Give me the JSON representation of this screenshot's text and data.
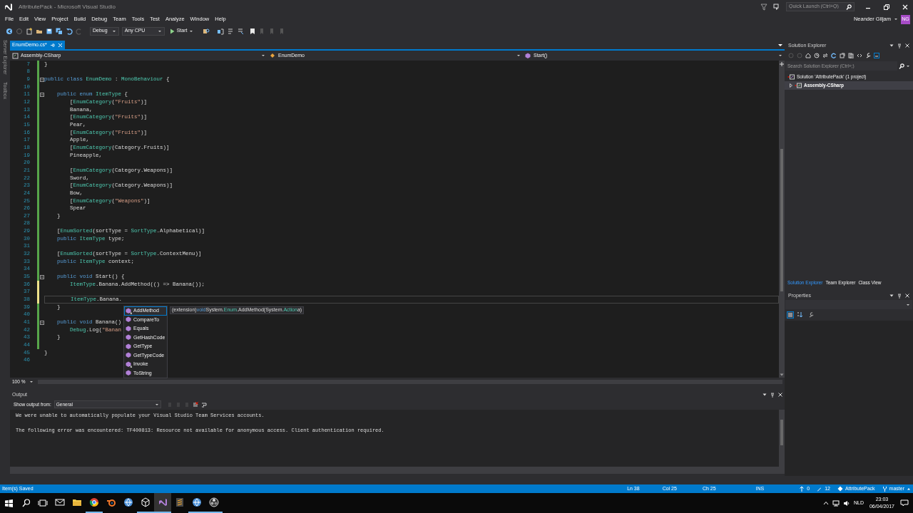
{
  "window": {
    "title": "AttributePack - Microsoft Visual Studio",
    "quick_launch": {
      "placeholder": "Quick Launch (Ctrl+Q)"
    },
    "user": {
      "name": "Neander Giljam",
      "initials": "NG"
    }
  },
  "menu": [
    "File",
    "Edit",
    "View",
    "Project",
    "Build",
    "Debug",
    "Team",
    "Tools",
    "Test",
    "Analyze",
    "Window",
    "Help"
  ],
  "toolbar": {
    "configuration": "Debug",
    "platform": "Any CPU",
    "start": "Start"
  },
  "side_tabs": [
    "Server Explorer",
    "Toolbox"
  ],
  "editor": {
    "tabs": [
      {
        "label": "EnumDemo.cs*",
        "selected": true
      }
    ],
    "nav": [
      "Assembly-CSharp",
      "EnumDemo",
      "Start()"
    ],
    "lines": [
      {
        "n": "7",
        "code": [
          {
            "text": "}",
            "kind": "plain"
          }
        ],
        "changed": true,
        "saved": true,
        "fold": false,
        "current": false
      },
      {
        "n": "8",
        "changed": true,
        "saved": true,
        "fold": false,
        "current": false
      },
      {
        "n": "9",
        "code": [
          {
            "text": "public ",
            "kind": "keyword"
          },
          {
            "text": "class ",
            "kind": "keyword"
          },
          {
            "text": "EnumDemo",
            "kind": "type"
          },
          {
            "text": " : ",
            "kind": "plain"
          },
          {
            "text": "MonoBehaviour",
            "kind": "type"
          },
          {
            "text": " {",
            "kind": "plain"
          }
        ],
        "changed": true,
        "saved": true,
        "fold": true,
        "current": false
      },
      {
        "n": "10",
        "changed": true,
        "saved": true,
        "fold": false,
        "current": false
      },
      {
        "n": "11",
        "code": [
          {
            "text": "    public ",
            "kind": "keyword"
          },
          {
            "text": "enum ",
            "kind": "keyword"
          },
          {
            "text": "ItemType",
            "kind": "type"
          },
          {
            "text": " {",
            "kind": "plain"
          }
        ],
        "changed": true,
        "saved": true,
        "fold": true,
        "current": false
      },
      {
        "n": "12",
        "code": [
          {
            "text": "        [",
            "kind": "plain"
          },
          {
            "text": "EnumCategory",
            "kind": "type"
          },
          {
            "text": "(",
            "kind": "plain"
          },
          {
            "text": "\"Fruits\"",
            "kind": "string"
          },
          {
            "text": ")]",
            "kind": "plain"
          }
        ],
        "changed": true,
        "saved": true,
        "fold": false,
        "current": false
      },
      {
        "n": "13",
        "code": [
          {
            "text": "        Banana,",
            "kind": "plain"
          }
        ],
        "changed": true,
        "saved": true,
        "fold": false,
        "current": false
      },
      {
        "n": "14",
        "code": [
          {
            "text": "        [",
            "kind": "plain"
          },
          {
            "text": "EnumCategory",
            "kind": "type"
          },
          {
            "text": "(",
            "kind": "plain"
          },
          {
            "text": "\"Fruits\"",
            "kind": "string"
          },
          {
            "text": ")]",
            "kind": "plain"
          }
        ],
        "changed": true,
        "saved": true,
        "fold": false,
        "current": false
      },
      {
        "n": "15",
        "code": [
          {
            "text": "        Pear,",
            "kind": "plain"
          }
        ],
        "changed": true,
        "saved": true,
        "fold": false,
        "current": false
      },
      {
        "n": "16",
        "code": [
          {
            "text": "        [",
            "kind": "plain"
          },
          {
            "text": "EnumCategory",
            "kind": "type"
          },
          {
            "text": "(",
            "kind": "plain"
          },
          {
            "text": "\"Fruits\"",
            "kind": "string"
          },
          {
            "text": ")]",
            "kind": "plain"
          }
        ],
        "changed": true,
        "saved": true,
        "fold": false,
        "current": false
      },
      {
        "n": "17",
        "code": [
          {
            "text": "        Apple,",
            "kind": "plain"
          }
        ],
        "changed": true,
        "saved": true,
        "fold": false,
        "current": false
      },
      {
        "n": "18",
        "code": [
          {
            "text": "        [",
            "kind": "plain"
          },
          {
            "text": "EnumCategory",
            "kind": "type"
          },
          {
            "text": "(Category.Fruits)]",
            "kind": "plain"
          }
        ],
        "changed": true,
        "saved": true,
        "fold": false,
        "current": false
      },
      {
        "n": "19",
        "code": [
          {
            "text": "        Pineapple,",
            "kind": "plain"
          }
        ],
        "changed": true,
        "saved": true,
        "fold": false,
        "current": false
      },
      {
        "n": "20",
        "changed": true,
        "saved": true,
        "fold": false,
        "current": false
      },
      {
        "n": "21",
        "code": [
          {
            "text": "        [",
            "kind": "plain"
          },
          {
            "text": "EnumCategory",
            "kind": "type"
          },
          {
            "text": "(Category.Weapons)]",
            "kind": "plain"
          }
        ],
        "changed": true,
        "saved": true,
        "fold": false,
        "current": false
      },
      {
        "n": "22",
        "code": [
          {
            "text": "        Sword,",
            "kind": "plain"
          }
        ],
        "changed": true,
        "saved": true,
        "fold": false,
        "current": false
      },
      {
        "n": "23",
        "code": [
          {
            "text": "        [",
            "kind": "plain"
          },
          {
            "text": "EnumCategory",
            "kind": "type"
          },
          {
            "text": "(Category.Weapons)]",
            "kind": "plain"
          }
        ],
        "changed": true,
        "saved": true,
        "fold": false,
        "current": false
      },
      {
        "n": "24",
        "code": [
          {
            "text": "        Bow,",
            "kind": "plain"
          }
        ],
        "changed": true,
        "saved": true,
        "fold": false,
        "current": false
      },
      {
        "n": "25",
        "code": [
          {
            "text": "        [",
            "kind": "plain"
          },
          {
            "text": "EnumCategory",
            "kind": "type"
          },
          {
            "text": "(",
            "kind": "plain"
          },
          {
            "text": "\"Weapons\"",
            "kind": "string"
          },
          {
            "text": ")]",
            "kind": "plain"
          }
        ],
        "changed": true,
        "saved": true,
        "fold": false,
        "current": false
      },
      {
        "n": "26",
        "code": [
          {
            "text": "        Spear",
            "kind": "plain"
          }
        ],
        "changed": true,
        "saved": true,
        "fold": false,
        "current": false
      },
      {
        "n": "27",
        "code": [
          {
            "text": "    }",
            "kind": "plain"
          }
        ],
        "changed": true,
        "saved": true,
        "fold": false,
        "current": false
      },
      {
        "n": "28",
        "changed": true,
        "saved": true,
        "fold": false,
        "current": false
      },
      {
        "n": "29",
        "code": [
          {
            "text": "    [",
            "kind": "plain"
          },
          {
            "text": "EnumSorted",
            "kind": "type"
          },
          {
            "text": "(sortType = ",
            "kind": "plain"
          },
          {
            "text": "SortType",
            "kind": "type"
          },
          {
            "text": ".Alphabetical)]",
            "kind": "plain"
          }
        ],
        "changed": true,
        "saved": true,
        "fold": false,
        "current": false
      },
      {
        "n": "30",
        "code": [
          {
            "text": "    public ",
            "kind": "keyword"
          },
          {
            "text": "ItemType",
            "kind": "type"
          },
          {
            "text": " type;",
            "kind": "plain"
          }
        ],
        "changed": true,
        "saved": true,
        "fold": false,
        "current": false
      },
      {
        "n": "31",
        "changed": true,
        "saved": true,
        "fold": false,
        "current": false
      },
      {
        "n": "32",
        "code": [
          {
            "text": "    [",
            "kind": "plain"
          },
          {
            "text": "EnumSorted",
            "kind": "type"
          },
          {
            "text": "(sortType = ",
            "kind": "plain"
          },
          {
            "text": "SortType",
            "kind": "type"
          },
          {
            "text": ".ContextMenu)]",
            "kind": "plain"
          }
        ],
        "changed": true,
        "saved": true,
        "fold": false,
        "current": false
      },
      {
        "n": "33",
        "code": [
          {
            "text": "    public ",
            "kind": "keyword"
          },
          {
            "text": "ItemType",
            "kind": "type"
          },
          {
            "text": " context;",
            "kind": "plain"
          }
        ],
        "changed": true,
        "saved": true,
        "fold": false,
        "current": false
      },
      {
        "n": "34",
        "changed": true,
        "saved": true,
        "fold": false,
        "current": false
      },
      {
        "n": "35",
        "code": [
          {
            "text": "    public ",
            "kind": "keyword"
          },
          {
            "text": "void ",
            "kind": "keyword"
          },
          {
            "text": "Start() {",
            "kind": "plain"
          }
        ],
        "changed": true,
        "saved": true,
        "fold": true,
        "current": false
      },
      {
        "n": "36",
        "code": [
          {
            "text": "        ItemType",
            "kind": "type"
          },
          {
            "text": ".Banana.AddMethod(() => Banana());",
            "kind": "plain"
          }
        ],
        "changed": true,
        "saved": false,
        "fold": false,
        "current": false
      },
      {
        "n": "37",
        "changed": true,
        "saved": false,
        "fold": false,
        "current": false
      },
      {
        "n": "38",
        "code": [
          {
            "text": "        ItemType",
            "kind": "type"
          },
          {
            "text": ".Banana.",
            "kind": "plain"
          }
        ],
        "changed": true,
        "saved": false,
        "fold": false,
        "current": true
      },
      {
        "n": "39",
        "code": [
          {
            "text": "    }",
            "kind": "plain"
          }
        ],
        "changed": true,
        "saved": true,
        "fold": false,
        "current": false
      },
      {
        "n": "40",
        "changed": true,
        "saved": true,
        "fold": false,
        "current": false
      },
      {
        "n": "41",
        "code": [
          {
            "text": "    public ",
            "kind": "keyword"
          },
          {
            "text": "void ",
            "kind": "keyword"
          },
          {
            "text": "Banana()",
            "kind": "plain"
          }
        ],
        "changed": true,
        "saved": true,
        "fold": true,
        "current": false
      },
      {
        "n": "42",
        "code": [
          {
            "text": "        Debug",
            "kind": "type"
          },
          {
            "text": ".Log(",
            "kind": "plain"
          },
          {
            "text": "\"Banan",
            "kind": "string"
          }
        ],
        "changed": true,
        "saved": true,
        "fold": false,
        "current": false
      },
      {
        "n": "43",
        "code": [
          {
            "text": "    }",
            "kind": "plain"
          }
        ],
        "changed": true,
        "saved": true,
        "fold": false,
        "current": false
      },
      {
        "n": "44",
        "changed": true,
        "saved": true,
        "fold": false,
        "current": false
      },
      {
        "n": "45",
        "code": [
          {
            "text": "}",
            "kind": "plain"
          }
        ],
        "changed": false,
        "fold": false,
        "current": false
      },
      {
        "n": "46",
        "changed": false,
        "fold": false,
        "current": false
      }
    ],
    "completion": {
      "items": [
        {
          "label": "AddMethod",
          "kind": "extension",
          "selected": true
        },
        {
          "label": "CompareTo",
          "kind": "method",
          "selected": false
        },
        {
          "label": "Equals",
          "kind": "method",
          "selected": false
        },
        {
          "label": "GetHashCode",
          "kind": "method",
          "selected": false
        },
        {
          "label": "GetType",
          "kind": "method",
          "selected": false
        },
        {
          "label": "GetTypeCode",
          "kind": "method",
          "selected": false
        },
        {
          "label": "Invoke",
          "kind": "extension",
          "selected": false
        },
        {
          "label": "ToString",
          "kind": "method",
          "selected": false
        }
      ],
      "tooltip": [
        {
          "text": "(extension) ",
          "kind": "plain"
        },
        {
          "text": "void ",
          "kind": "keyword"
        },
        {
          "text": "System.",
          "kind": "plain"
        },
        {
          "text": "Enum",
          "kind": "type"
        },
        {
          "text": ".AddMethod(System.",
          "kind": "plain"
        },
        {
          "text": "Action",
          "kind": "type"
        },
        {
          "text": " a)",
          "kind": "plain"
        }
      ]
    },
    "zoom": "100 %"
  },
  "output": {
    "title": "Output",
    "source_label": "Show output from:",
    "source": "General",
    "lines": [
      "We were unable to automatically populate your Visual Studio Team Services accounts.",
      "The following error was encountered: TF400813: Resource not available for anonymous access. Client authentication required."
    ]
  },
  "solution_explorer": {
    "title": "Solution Explorer",
    "search": {
      "placeholder": "Search Solution Explorer (Ctrl+;)"
    },
    "tree": [
      {
        "label": "Solution 'AttributePack' (1 project)",
        "selected": false,
        "children": [
          {
            "label": "Assembly-CSharp",
            "selected": true,
            "expanded": false
          }
        ]
      }
    ]
  },
  "panel_tabs": [
    {
      "label": "Solution Explorer",
      "selected": true
    },
    {
      "label": "Team Explorer",
      "selected": false
    },
    {
      "label": "Class View",
      "selected": false
    }
  ],
  "properties": {
    "title": "Properties"
  },
  "status_bar": {
    "message": "Item(s) Saved",
    "line": "Ln 38",
    "column": "Col 25",
    "char": "Ch 25",
    "mode": "INS",
    "pushes": "0",
    "changes": "12",
    "repository": "AttributePack",
    "branch": "master"
  },
  "taskbar": {
    "apps": [
      {
        "kind": "mail",
        "running": false,
        "selected": false
      },
      {
        "kind": "folder",
        "running": false,
        "selected": false
      },
      {
        "kind": "browser",
        "running": true,
        "selected": false
      },
      {
        "kind": "blender",
        "running": false,
        "selected": false
      },
      {
        "kind": "globe",
        "running": false,
        "selected": false
      },
      {
        "kind": "cube",
        "running": true,
        "selected": false
      },
      {
        "kind": "studio",
        "running": true,
        "selected": true
      },
      {
        "kind": "editor",
        "running": false,
        "selected": false
      },
      {
        "kind": "globe",
        "running": true,
        "selected": false
      },
      {
        "kind": "recorder",
        "running": true,
        "selected": false
      }
    ],
    "language": "NLD",
    "time": "23:03",
    "date": "06/04/2017"
  }
}
